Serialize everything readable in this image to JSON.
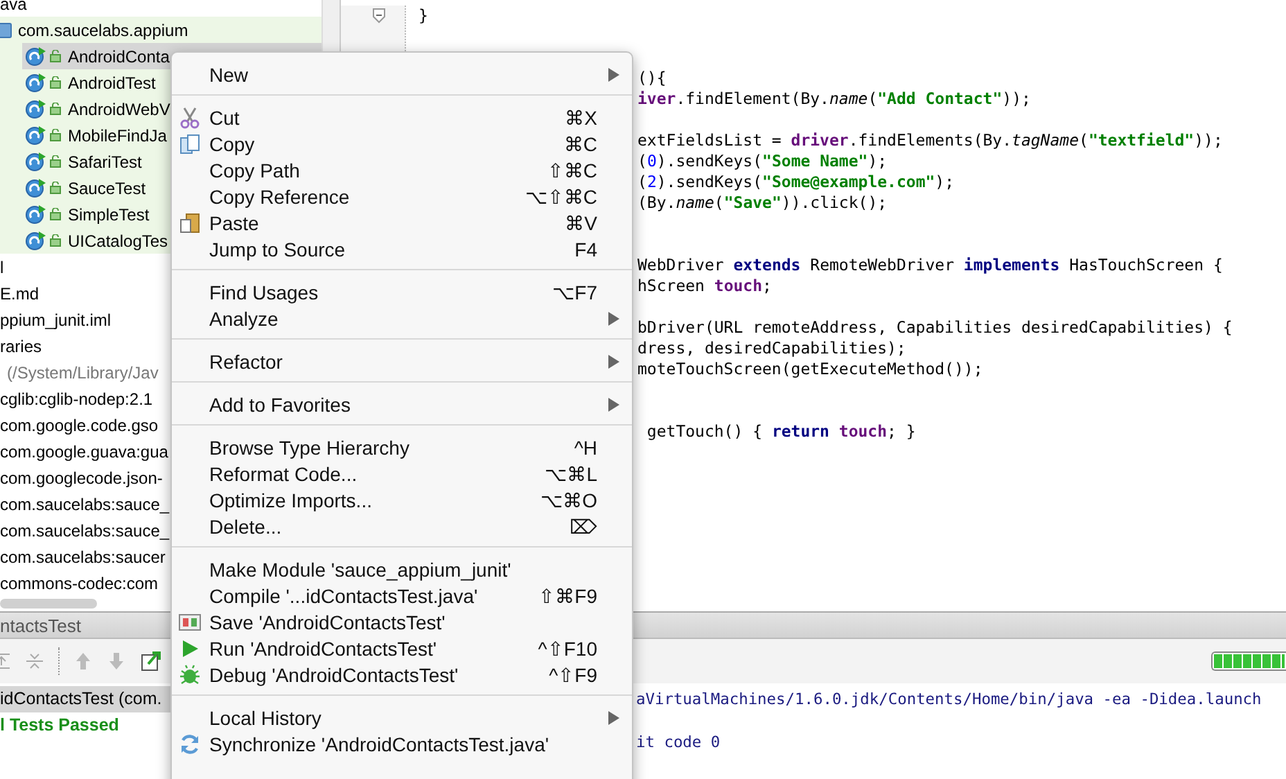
{
  "project_tree": [
    {
      "label": "ava",
      "kind": "plain"
    },
    {
      "label": "com.saucelabs.appium",
      "kind": "package",
      "children": [
        {
          "label": "AndroidConta",
          "kind": "test_class",
          "selected": true
        },
        {
          "label": "AndroidTest",
          "kind": "test_class",
          "selected": false
        },
        {
          "label": "AndroidWebV",
          "kind": "test_class",
          "selected": false
        },
        {
          "label": "MobileFindJa",
          "kind": "test_class",
          "selected": false
        },
        {
          "label": "SafariTest",
          "kind": "test_class",
          "selected": false
        },
        {
          "label": "SauceTest",
          "kind": "test_class",
          "selected": false
        },
        {
          "label": "SimpleTest",
          "kind": "test_class",
          "selected": false
        },
        {
          "label": "UICatalogTes",
          "kind": "test_class",
          "selected": false
        }
      ]
    },
    {
      "label": "l",
      "kind": "plain"
    },
    {
      "label": "E.md",
      "kind": "plain"
    },
    {
      "label": "ppium_junit.iml",
      "kind": "plain"
    },
    {
      "label": "raries",
      "kind": "plain"
    },
    {
      "label": "(/System/Library/Jav",
      "kind": "note"
    },
    {
      "label": "cglib:cglib-nodep:2.1",
      "kind": "plain"
    },
    {
      "label": "com.google.code.gso",
      "kind": "plain"
    },
    {
      "label": "com.google.guava:gua",
      "kind": "plain"
    },
    {
      "label": "com.googlecode.json-",
      "kind": "plain"
    },
    {
      "label": "com.saucelabs:sauce_",
      "kind": "plain"
    },
    {
      "label": "com.saucelabs:sauce_",
      "kind": "plain"
    },
    {
      "label": "com.saucelabs:saucer",
      "kind": "plain"
    },
    {
      "label": "commons-codec:com",
      "kind": "plain"
    }
  ],
  "editor": {
    "lines": [
      {
        "kind": "block",
        "fold": true,
        "segments": [
          {
            "kind": "plain",
            "text": "}"
          }
        ]
      },
      {
        "kind": "blank"
      },
      {
        "kind": "blank"
      },
      {
        "kind": "partial",
        "segments": [
          {
            "kind": "plain",
            "text": "(){"
          }
        ]
      },
      {
        "kind": "partial",
        "segments": [
          {
            "kind": "field",
            "text": "iver"
          },
          {
            "kind": "plain",
            "text": ".findElement(By."
          },
          {
            "kind": "italic",
            "text": "name"
          },
          {
            "kind": "plain",
            "text": "("
          },
          {
            "kind": "string",
            "text": "\"Add Contact\""
          },
          {
            "kind": "plain",
            "text": "));"
          }
        ]
      },
      {
        "kind": "blank"
      },
      {
        "kind": "partial",
        "segments": [
          {
            "kind": "plain",
            "text": "extFieldsList = "
          },
          {
            "kind": "field",
            "text": "driver"
          },
          {
            "kind": "plain",
            "text": ".findElements(By."
          },
          {
            "kind": "italic",
            "text": "tagName"
          },
          {
            "kind": "plain",
            "text": "("
          },
          {
            "kind": "string",
            "text": "\"textfield\""
          },
          {
            "kind": "plain",
            "text": "));"
          }
        ]
      },
      {
        "kind": "partial",
        "segments": [
          {
            "kind": "plain",
            "text": "("
          },
          {
            "kind": "number",
            "text": "0"
          },
          {
            "kind": "plain",
            "text": ").sendKeys("
          },
          {
            "kind": "string",
            "text": "\"Some Name\""
          },
          {
            "kind": "plain",
            "text": ");"
          }
        ]
      },
      {
        "kind": "partial",
        "segments": [
          {
            "kind": "plain",
            "text": "("
          },
          {
            "kind": "number",
            "text": "2"
          },
          {
            "kind": "plain",
            "text": ").sendKeys("
          },
          {
            "kind": "string",
            "text": "\"Some@example.com\""
          },
          {
            "kind": "plain",
            "text": ");"
          }
        ]
      },
      {
        "kind": "partial",
        "segments": [
          {
            "kind": "plain",
            "text": "(By."
          },
          {
            "kind": "italic",
            "text": "name"
          },
          {
            "kind": "plain",
            "text": "("
          },
          {
            "kind": "string",
            "text": "\"Save\""
          },
          {
            "kind": "plain",
            "text": ")).click();"
          }
        ]
      },
      {
        "kind": "blank"
      },
      {
        "kind": "blank"
      },
      {
        "kind": "partial",
        "segments": [
          {
            "kind": "plain",
            "text": "WebDriver "
          },
          {
            "kind": "keyword",
            "text": "extends"
          },
          {
            "kind": "plain",
            "text": " RemoteWebDriver "
          },
          {
            "kind": "keyword",
            "text": "implements"
          },
          {
            "kind": "plain",
            "text": " HasTouchScreen {"
          }
        ]
      },
      {
        "kind": "partial",
        "segments": [
          {
            "kind": "plain",
            "text": "hScreen "
          },
          {
            "kind": "field",
            "text": "touch"
          },
          {
            "kind": "plain",
            "text": ";"
          }
        ]
      },
      {
        "kind": "blank"
      },
      {
        "kind": "partial",
        "segments": [
          {
            "kind": "plain",
            "text": "bDriver(URL remoteAddress, Capabilities desiredCapabilities) {"
          }
        ]
      },
      {
        "kind": "partial",
        "segments": [
          {
            "kind": "plain",
            "text": "dress, desiredCapabilities);"
          }
        ]
      },
      {
        "kind": "partial",
        "segments": [
          {
            "kind": "plain",
            "text": "moteTouchScreen(getExecuteMethod());"
          }
        ]
      },
      {
        "kind": "blank"
      },
      {
        "kind": "blank"
      },
      {
        "kind": "partial",
        "segments": [
          {
            "kind": "plain",
            "text": " getTouch() { "
          },
          {
            "kind": "keyword",
            "text": "return "
          },
          {
            "kind": "field",
            "text": "touch"
          },
          {
            "kind": "plain",
            "text": "; }"
          }
        ]
      }
    ]
  },
  "run_panel": {
    "title": "ntactsTest",
    "progress": {
      "level": 1
    },
    "results": [
      {
        "label": "idContactsTest (com.",
        "kind": "test_row",
        "selected": true
      },
      {
        "label": "l Tests Passed",
        "kind": "status",
        "selected": false
      }
    ],
    "console": [
      {
        "kind": "command",
        "text": "aVirtualMachines/1.6.0.jdk/Contents/Home/bin/java -ea -Didea.launch"
      },
      {
        "kind": "exit",
        "text": "it code 0"
      }
    ]
  },
  "context_menu": {
    "groups": [
      [
        {
          "label": "New",
          "submenu": true
        }
      ],
      [
        {
          "label": "Cut",
          "shortcut": "⌘X",
          "submenu": false
        },
        {
          "label": "Copy",
          "shortcut": "⌘C",
          "submenu": false
        },
        {
          "label": "Copy Path",
          "shortcut": "⇧⌘C",
          "submenu": false
        },
        {
          "label": "Copy Reference",
          "shortcut": "⌥⇧⌘C",
          "submenu": false
        },
        {
          "label": "Paste",
          "shortcut": "⌘V",
          "submenu": false
        },
        {
          "label": "Jump to Source",
          "shortcut": "F4",
          "submenu": false
        }
      ],
      [
        {
          "label": "Find Usages",
          "shortcut": "⌥F7",
          "submenu": false
        },
        {
          "label": "Analyze",
          "submenu": true
        }
      ],
      [
        {
          "label": "Refactor",
          "submenu": true
        }
      ],
      [
        {
          "label": "Add to Favorites",
          "submenu": true
        }
      ],
      [
        {
          "label": "Browse Type Hierarchy",
          "shortcut": "^H",
          "submenu": false
        },
        {
          "label": "Reformat Code...",
          "shortcut": "⌥⌘L",
          "submenu": false
        },
        {
          "label": "Optimize Imports...",
          "shortcut": "⌥⌘O",
          "submenu": false
        },
        {
          "label": "Delete...",
          "shortcut": "⌦",
          "submenu": false
        }
      ],
      [
        {
          "label": "Make Module 'sauce_appium_junit'",
          "submenu": false
        },
        {
          "label": "Compile '...idContactsTest.java'",
          "shortcut": "⇧⌘F9",
          "submenu": false
        },
        {
          "label": "Save 'AndroidContactsTest'",
          "submenu": false
        },
        {
          "label": "Run 'AndroidContactsTest'",
          "shortcut": "^⇧F10",
          "submenu": false
        },
        {
          "label": "Debug 'AndroidContactsTest'",
          "shortcut": "^⇧F9",
          "submenu": false
        }
      ],
      [
        {
          "label": "Local History",
          "submenu": true
        },
        {
          "label": "Synchronize 'AndroidContactsTest.java'",
          "submenu": false
        }
      ]
    ]
  }
}
